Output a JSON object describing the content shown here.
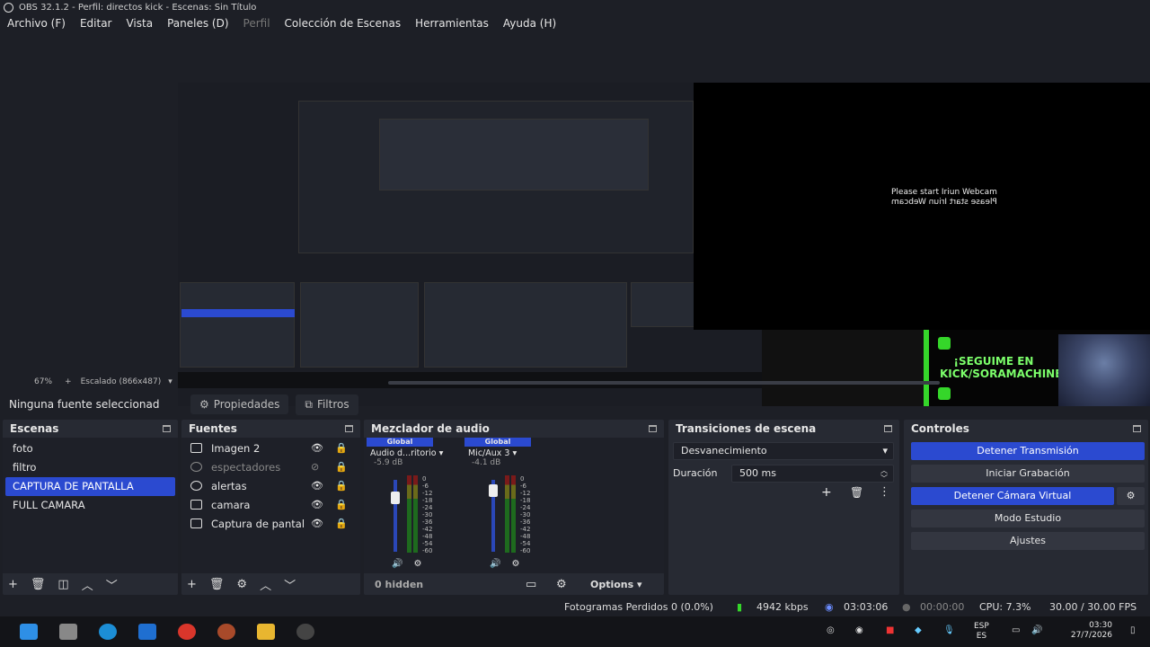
{
  "window": {
    "title": "OBS 32.1.2 - Perfil: directos kick - Escenas: Sin Título"
  },
  "menu": [
    "Archivo (F)",
    "Editar",
    "Vista",
    "Paneles (D)",
    "Perfil",
    "Colección de Escenas",
    "Herramientas",
    "Ayuda (H)"
  ],
  "preview": {
    "webcam_message": "Please start Iriun Webcam",
    "banner_text": "¡SEGUIME EN KICK/SORAMACHINE!",
    "zoom": "67%",
    "scaling": "Escalado (866x487)"
  },
  "context": {
    "no_source": "Ninguna fuente seleccionad",
    "properties": "Propiedades",
    "filters": "Filtros"
  },
  "scenes": {
    "title": "Escenas",
    "items": [
      "foto",
      "filtro",
      "CAPTURA DE PANTALLA",
      "FULL CAMARA"
    ],
    "selected_index": 2
  },
  "sources": {
    "title": "Fuentes",
    "items": [
      {
        "name": "Imagen 2",
        "icon": "image-icon",
        "visible": true
      },
      {
        "name": "espectadores",
        "icon": "browser-icon",
        "visible": false
      },
      {
        "name": "alertas",
        "icon": "browser-icon",
        "visible": true
      },
      {
        "name": "camara",
        "icon": "camera-icon",
        "visible": true
      },
      {
        "name": "Captura de pantal",
        "icon": "monitor-icon",
        "visible": true
      }
    ]
  },
  "mixer": {
    "title": "Mezclador de audio",
    "channels": [
      {
        "global": "Global",
        "name": "Audio d...ritorio",
        "db": "-5.9 dB"
      },
      {
        "global": "Global",
        "name": "Mic/Aux 3",
        "db": "-4.1 dB"
      }
    ],
    "scale": [
      "0",
      "-6",
      "-12",
      "-18",
      "-24",
      "-30",
      "-36",
      "-42",
      "-48",
      "-54",
      "-60"
    ],
    "hidden": "0 hidden",
    "options": "Options"
  },
  "transitions": {
    "title": "Transiciones de escena",
    "type": "Desvanecimiento",
    "duration_label": "Duración",
    "duration_value": "500 ms"
  },
  "controls": {
    "title": "Controles",
    "stop_stream": "Detener Transmisión",
    "start_record": "Iniciar Grabación",
    "stop_virtualcam": "Detener Cámara Virtual",
    "studio_mode": "Modo Estudio",
    "settings": "Ajustes"
  },
  "status": {
    "dropped": "Fotogramas Perdidos 0 (0.0%)",
    "bitrate": "4942 kbps",
    "stream_time": "03:03:06",
    "record_time": "00:00:00",
    "cpu": "CPU: 7.3%",
    "fps": "30.00 / 30.00 FPS"
  },
  "taskbar": {
    "lang": "ESP",
    "region": "ES",
    "time": "03:30",
    "date": "27/7/2026"
  },
  "colors": {
    "accent": "#2b4ad0",
    "dock_bg": "#272a33",
    "bg": "#1d1f26"
  }
}
